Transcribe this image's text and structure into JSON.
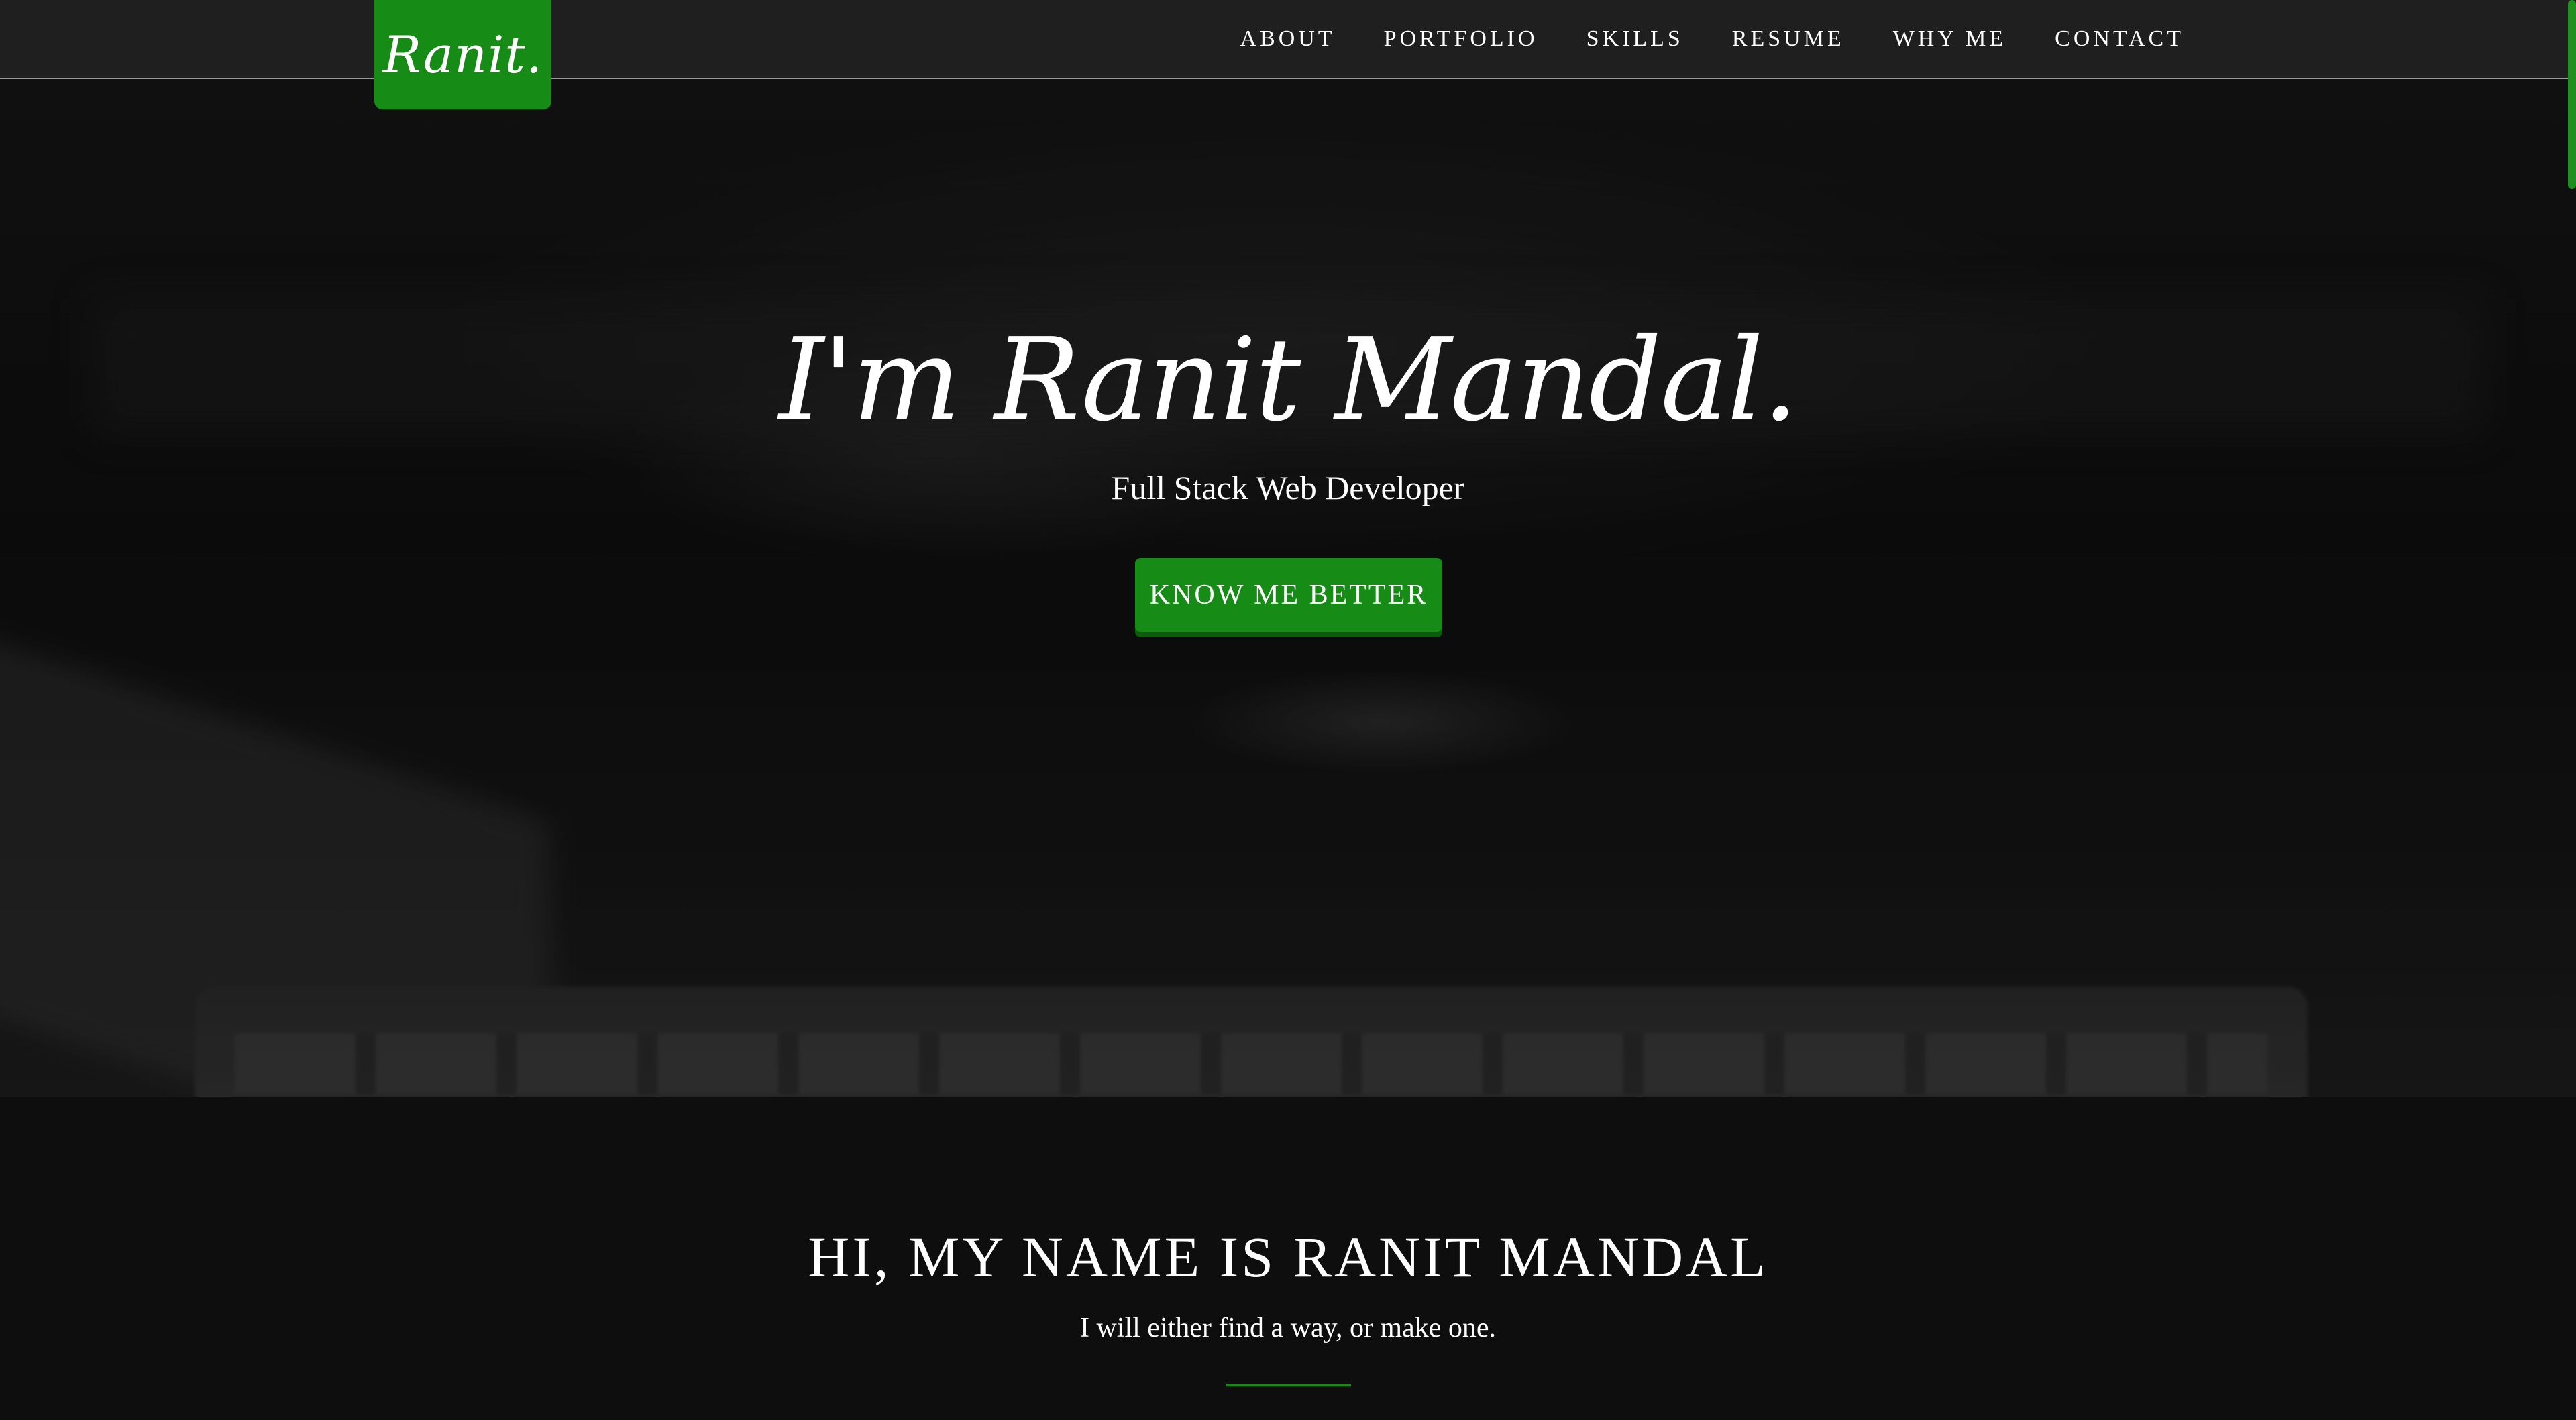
{
  "brand": {
    "logo_text": "Ranit.",
    "accent_color": "#168b16"
  },
  "nav": {
    "items": [
      {
        "label": "ABOUT"
      },
      {
        "label": "PORTFOLIO"
      },
      {
        "label": "SKILLS"
      },
      {
        "label": "RESUME"
      },
      {
        "label": "WHY ME"
      },
      {
        "label": "CONTACT"
      }
    ]
  },
  "hero": {
    "title": "I'm Ranit Mandal.",
    "subtitle": "Full Stack Web Developer",
    "cta_label": "KNOW ME BETTER"
  },
  "about": {
    "heading": "HI, MY NAME IS RANIT MANDAL",
    "tagline": "I will either find a way, or make one."
  }
}
